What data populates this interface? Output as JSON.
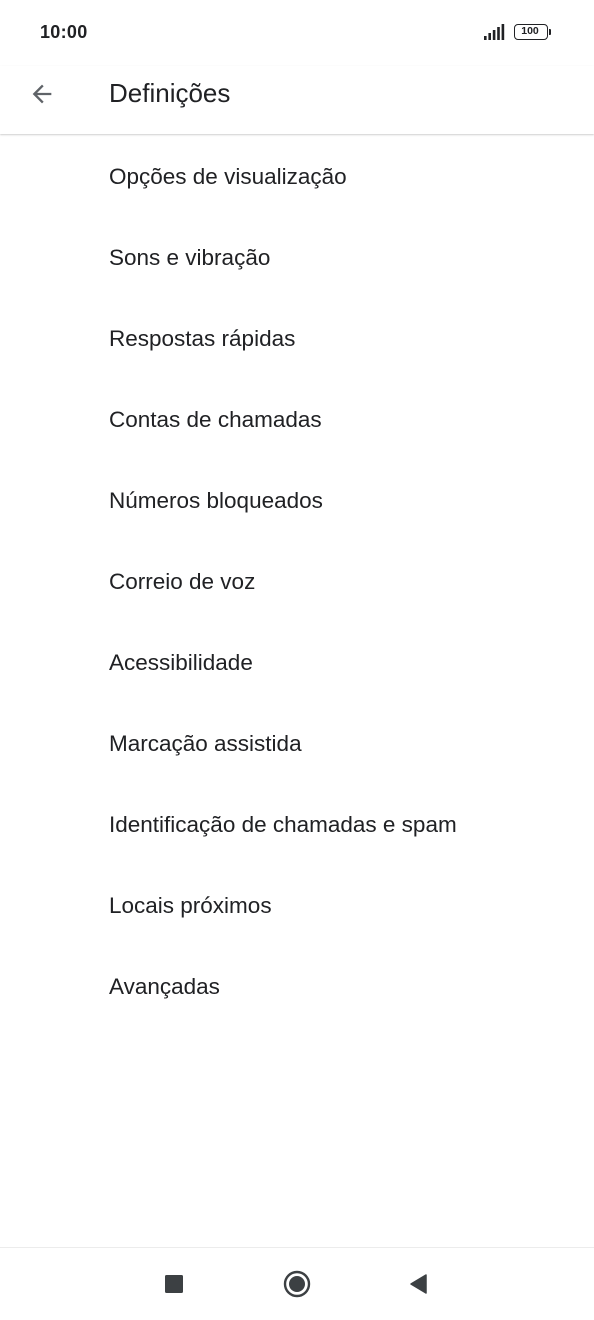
{
  "status_bar": {
    "time": "10:00",
    "battery_level": "100",
    "icons": [
      "signal-icon",
      "battery-icon"
    ]
  },
  "app_bar": {
    "back_icon": "arrow-back-icon",
    "title": "Definições"
  },
  "settings": {
    "items": [
      {
        "label": "Opções de visualização"
      },
      {
        "label": "Sons e vibração"
      },
      {
        "label": "Respostas rápidas"
      },
      {
        "label": "Contas de chamadas"
      },
      {
        "label": "Números bloqueados"
      },
      {
        "label": "Correio de voz"
      },
      {
        "label": "Acessibilidade"
      },
      {
        "label": "Marcação assistida"
      },
      {
        "label": "Identificação de chamadas e spam"
      },
      {
        "label": "Locais próximos"
      },
      {
        "label": "Avançadas"
      }
    ]
  },
  "nav_bar": {
    "icons": [
      "recents-square-icon",
      "home-circle-icon",
      "back-triangle-icon"
    ]
  },
  "colors": {
    "text_primary": "#202124",
    "icon_gray": "#5f6368",
    "nav_icon": "#3c4043",
    "background": "#ffffff"
  }
}
